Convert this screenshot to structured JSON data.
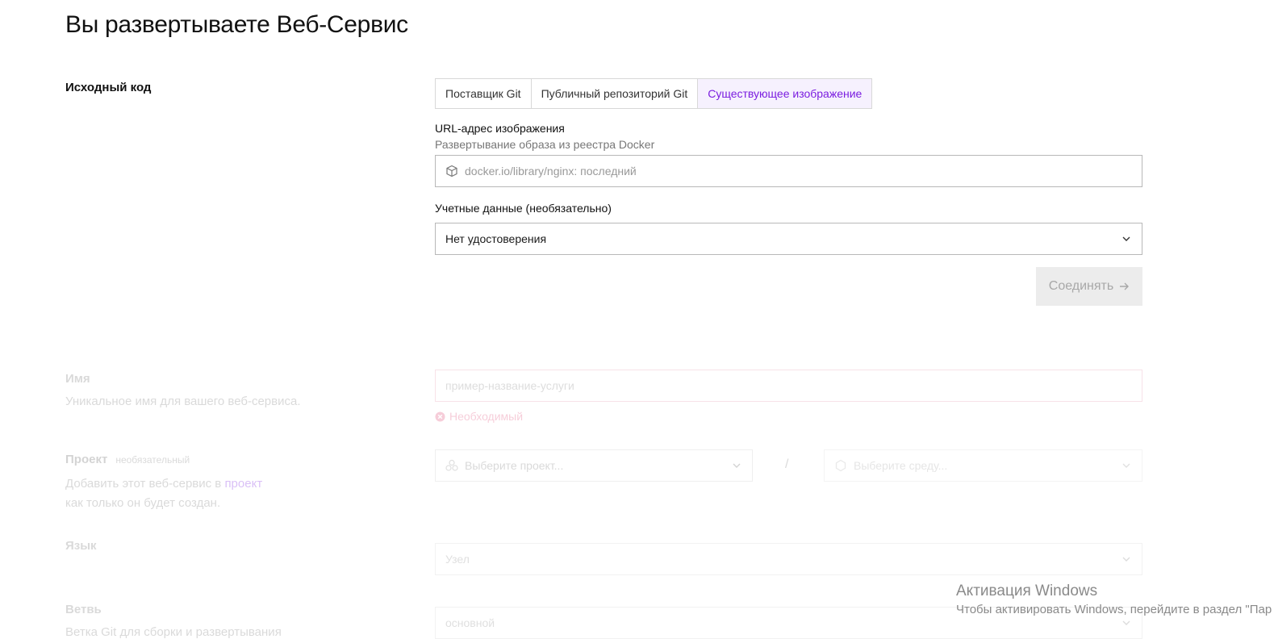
{
  "page": {
    "title": "Вы развертываете Веб-Сервис"
  },
  "source_code": {
    "label": "Исходный код",
    "tabs": [
      {
        "label": "Поставщик Git",
        "active": false
      },
      {
        "label": "Публичный репозиторий Git",
        "active": false
      },
      {
        "label": "Существующее изображение",
        "active": true
      }
    ],
    "image_url": {
      "label": "URL-адрес изображения",
      "help": "Развертывание образа из реестра Docker",
      "placeholder": "docker.io/library/nginx: последний",
      "icon": "package-icon"
    },
    "credentials": {
      "label": "Учетные данные (необязательно)",
      "value": "Нет удостоверения"
    },
    "connect_button": "Соединять"
  },
  "name": {
    "label": "Имя",
    "help": "Уникальное имя для вашего веб-сервиса.",
    "placeholder": "пример-название-услуги",
    "error": "Необходимый"
  },
  "project": {
    "label": "Проект",
    "optional": "необязательный",
    "help_prefix": "Добавить этот веб-сервис в",
    "help_link": "проект",
    "help_suffix": "как только он будет создан.",
    "project_placeholder": "Выберите проект...",
    "separator": "/",
    "env_placeholder": "Выберите среду..."
  },
  "language": {
    "label": "Язык",
    "value": "Узел"
  },
  "branch": {
    "label": "Ветвь",
    "help": "Ветка Git для сборки и развертывания",
    "value": "основной"
  },
  "windows_watermark": {
    "title": "Активация Windows",
    "subtitle": "Чтобы активировать Windows, перейдите в раздел \"Пар"
  },
  "colors": {
    "accent": "#7b1de0",
    "error": "#e0507a",
    "muted": "#999999"
  }
}
